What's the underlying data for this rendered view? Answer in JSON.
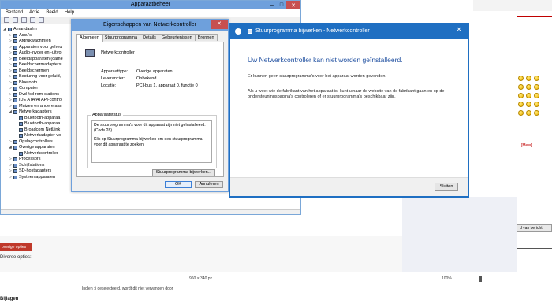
{
  "background": {
    "meer_link": "[Meer]",
    "post_button": "d van bericht",
    "options_tab": "overige opties",
    "diverse": "Diverse opties:",
    "indien_text": "Indien :) geselecteerd, wordt dit niet vervangen door",
    "bijlagen": "Bijlagen",
    "viewer_size": "960 × 340 px",
    "viewer_zoom": "100%"
  },
  "devmgr": {
    "title": "Apparaatbeheer",
    "menu": [
      "Bestand",
      "Actie",
      "Beeld",
      "Help"
    ],
    "tree": [
      {
        "label": "Amandaahh",
        "indent": 0,
        "arrow": "◢"
      },
      {
        "label": "Accu's",
        "indent": 1,
        "arrow": "▷"
      },
      {
        "label": "Afdrukwachtrijen",
        "indent": 1,
        "arrow": "▷"
      },
      {
        "label": "Apparaten voor geheu",
        "indent": 1,
        "arrow": "▷"
      },
      {
        "label": "Audio-invoer en -uitvo",
        "indent": 1,
        "arrow": "▷"
      },
      {
        "label": "Beeldapparaten (came",
        "indent": 1,
        "arrow": "▷"
      },
      {
        "label": "Beeldschermadapters",
        "indent": 1,
        "arrow": "▷"
      },
      {
        "label": "Beeldschermen",
        "indent": 1,
        "arrow": "▷"
      },
      {
        "label": "Besturing voor geluid,",
        "indent": 1,
        "arrow": "▷"
      },
      {
        "label": "Bluetooth",
        "indent": 1,
        "arrow": "▷"
      },
      {
        "label": "Computer",
        "indent": 1,
        "arrow": "▷"
      },
      {
        "label": "Dvd-/cd-rom-stations",
        "indent": 1,
        "arrow": "▷"
      },
      {
        "label": "IDE ATA/ATAPI-contro",
        "indent": 1,
        "arrow": "▷"
      },
      {
        "label": "Muizen en andere aan",
        "indent": 1,
        "arrow": "▷"
      },
      {
        "label": "Netwerkadapters",
        "indent": 1,
        "arrow": "◢"
      },
      {
        "label": "Bluetooth-apparaa",
        "indent": 2,
        "arrow": ""
      },
      {
        "label": "Bluetooth-apparaa",
        "indent": 2,
        "arrow": ""
      },
      {
        "label": "Broadcom NetLink",
        "indent": 2,
        "arrow": ""
      },
      {
        "label": "Netwerkadapter vo",
        "indent": 2,
        "arrow": ""
      },
      {
        "label": "Opslagcontrollers",
        "indent": 1,
        "arrow": "▷"
      },
      {
        "label": "Overige apparaten",
        "indent": 1,
        "arrow": "◢"
      },
      {
        "label": "Netwerkcontroller",
        "indent": 2,
        "arrow": ""
      },
      {
        "label": "Processors",
        "indent": 1,
        "arrow": "▷"
      },
      {
        "label": "Schijfstations",
        "indent": 1,
        "arrow": "▷"
      },
      {
        "label": "SD-hostadapters",
        "indent": 1,
        "arrow": "▷"
      },
      {
        "label": "Systeemapparaten",
        "indent": 1,
        "arrow": "▷"
      }
    ]
  },
  "props": {
    "title": "Eigenschappen van Netwerkcontroller",
    "tabs": [
      "Algemeen",
      "Stuurprogramma",
      "Details",
      "Gebeurtenissen",
      "Bronnen"
    ],
    "device_name": "Netwerkcontroller",
    "rows": [
      {
        "k": "Apparaattype:",
        "v": "Overige apparaten"
      },
      {
        "k": "Leverancier:",
        "v": "Onbekend"
      },
      {
        "k": "Locatie:",
        "v": "PCI-bus 1, apparaat 0, functie 0"
      }
    ],
    "status_legend": "Apparaatstatus",
    "status_p1": "De stuurprogramma's voor dit apparaat zijn niet geïnstalleerd. (Code 28)",
    "status_p2": "Klik op Stuurprogramma bijwerken om een stuurprogramma voor dit apparaat te zoeken.",
    "update_button": "Stuurprogramma bijwerken...",
    "ok_button": "OK",
    "cancel_button": "Annuleren"
  },
  "wizard": {
    "title": "Stuurprogramma bijwerken - Netwerkcontroller",
    "heading": "Uw Netwerkcontroller kan niet worden geïnstalleerd.",
    "p1": "Er kunnen geen stuurprogramma's voor het apparaat worden gevonden.",
    "p2": "Als u weet wie de fabrikant van het apparaat is, kunt u naar de website van de fabrikant gaan en op de ondersteuningspagina's controleren of er stuurprogramma's beschikbaar zijn.",
    "close_button": "Sluiten"
  }
}
